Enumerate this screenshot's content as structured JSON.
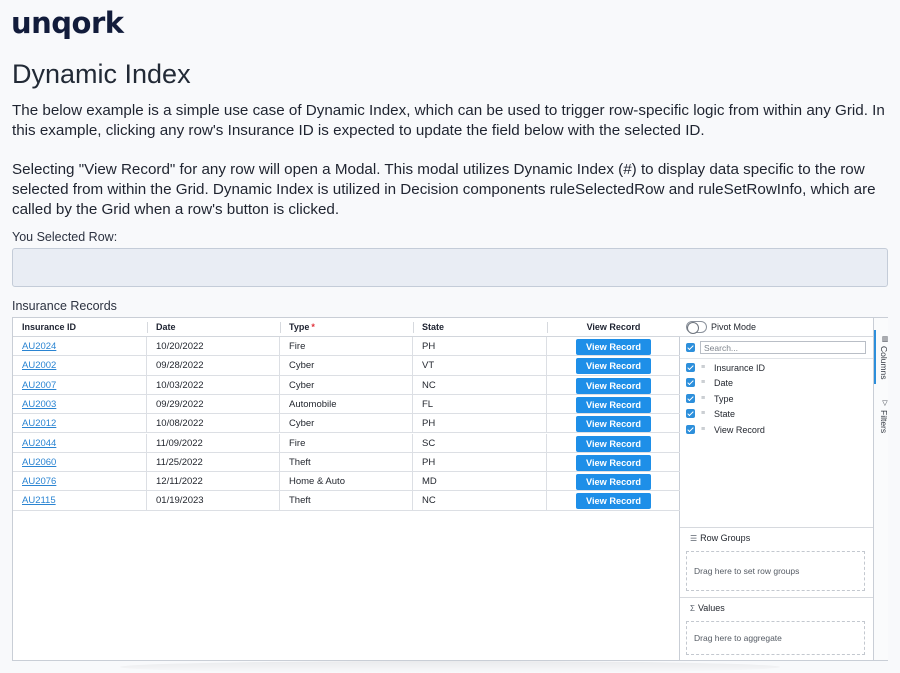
{
  "brand": {
    "logo_text": "unqork"
  },
  "page": {
    "title": "Dynamic Index",
    "paragraph_1": "The below example is a simple use case of Dynamic Index, which can be used to trigger row-specific logic from within any Grid. In this example, clicking any row's Insurance ID is expected to update the field below with the selected ID.",
    "paragraph_2": "Selecting \"View Record\" for any row will open a Modal. This modal utilizes Dynamic Index (#) to display data specific to the row selected from within the Grid. Dynamic Index is utilized in Decision components ruleSelectedRow and ruleSetRowInfo, which are called by the Grid when a row's button is clicked."
  },
  "selected_row": {
    "label": "You Selected Row:",
    "value": ""
  },
  "grid": {
    "label": "Insurance Records",
    "columns": [
      "Insurance ID",
      "Date",
      "Type",
      "State",
      "View Record"
    ],
    "required_marker": "*",
    "button_label": "View Record",
    "rows": [
      {
        "id": "AU2024",
        "date": "10/20/2022",
        "type": "Fire",
        "state": "PH"
      },
      {
        "id": "AU2002",
        "date": "09/28/2022",
        "type": "Cyber",
        "state": "VT"
      },
      {
        "id": "AU2007",
        "date": "10/03/2022",
        "type": "Cyber",
        "state": "NC"
      },
      {
        "id": "AU2003",
        "date": "09/29/2022",
        "type": "Automobile",
        "state": "FL"
      },
      {
        "id": "AU2012",
        "date": "10/08/2022",
        "type": "Cyber",
        "state": "PH"
      },
      {
        "id": "AU2044",
        "date": "11/09/2022",
        "type": "Fire",
        "state": "SC"
      },
      {
        "id": "AU2060",
        "date": "11/25/2022",
        "type": "Theft",
        "state": "PH"
      },
      {
        "id": "AU2076",
        "date": "12/11/2022",
        "type": "Home & Auto",
        "state": "MD"
      },
      {
        "id": "AU2115",
        "date": "01/19/2023",
        "type": "Theft",
        "state": "NC"
      }
    ]
  },
  "side_panel": {
    "pivot_mode_label": "Pivot Mode",
    "search_placeholder": "Search...",
    "column_items": [
      "Insurance ID",
      "Date",
      "Type",
      "State",
      "View Record"
    ],
    "row_groups_title": "Row Groups",
    "row_groups_drop": "Drag here to set row groups",
    "values_title": "Values",
    "values_drop": "Drag here to aggregate",
    "tab_columns": "Columns",
    "tab_filters": "Filters"
  },
  "colors": {
    "accent": "#1e8fe8",
    "link": "#2a84d2",
    "required": "#e0313b",
    "brand": "#121c3b"
  }
}
